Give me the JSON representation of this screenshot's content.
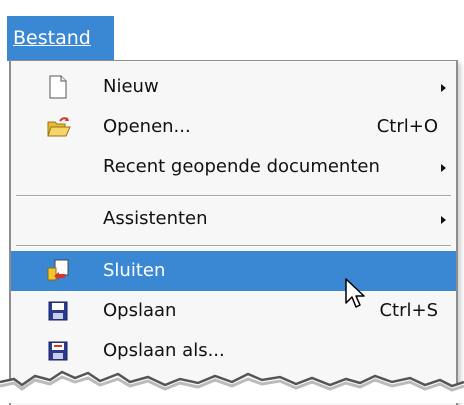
{
  "menubar": {
    "title": "Bestand"
  },
  "menu": {
    "items": [
      {
        "label": "Nieuw",
        "shortcut": "",
        "submenu": true,
        "icon": "new-document-icon"
      },
      {
        "label": "Openen...",
        "shortcut": "Ctrl+O",
        "submenu": false,
        "icon": "open-folder-icon"
      },
      {
        "label": "Recent geopende documenten",
        "shortcut": "",
        "submenu": true,
        "icon": ""
      },
      {
        "label": "Assistenten",
        "shortcut": "",
        "submenu": true,
        "icon": ""
      },
      {
        "label": "Sluiten",
        "shortcut": "",
        "submenu": false,
        "icon": "close-document-icon",
        "highlighted": true
      },
      {
        "label": "Opslaan",
        "shortcut": "Ctrl+S",
        "submenu": false,
        "icon": "save-icon"
      },
      {
        "label": "Opslaan als...",
        "shortcut": "",
        "submenu": false,
        "icon": "save-as-icon"
      }
    ]
  },
  "colors": {
    "highlight": "#3a88d4",
    "menu_bg": "#f7f7f7",
    "text": "#111111"
  }
}
